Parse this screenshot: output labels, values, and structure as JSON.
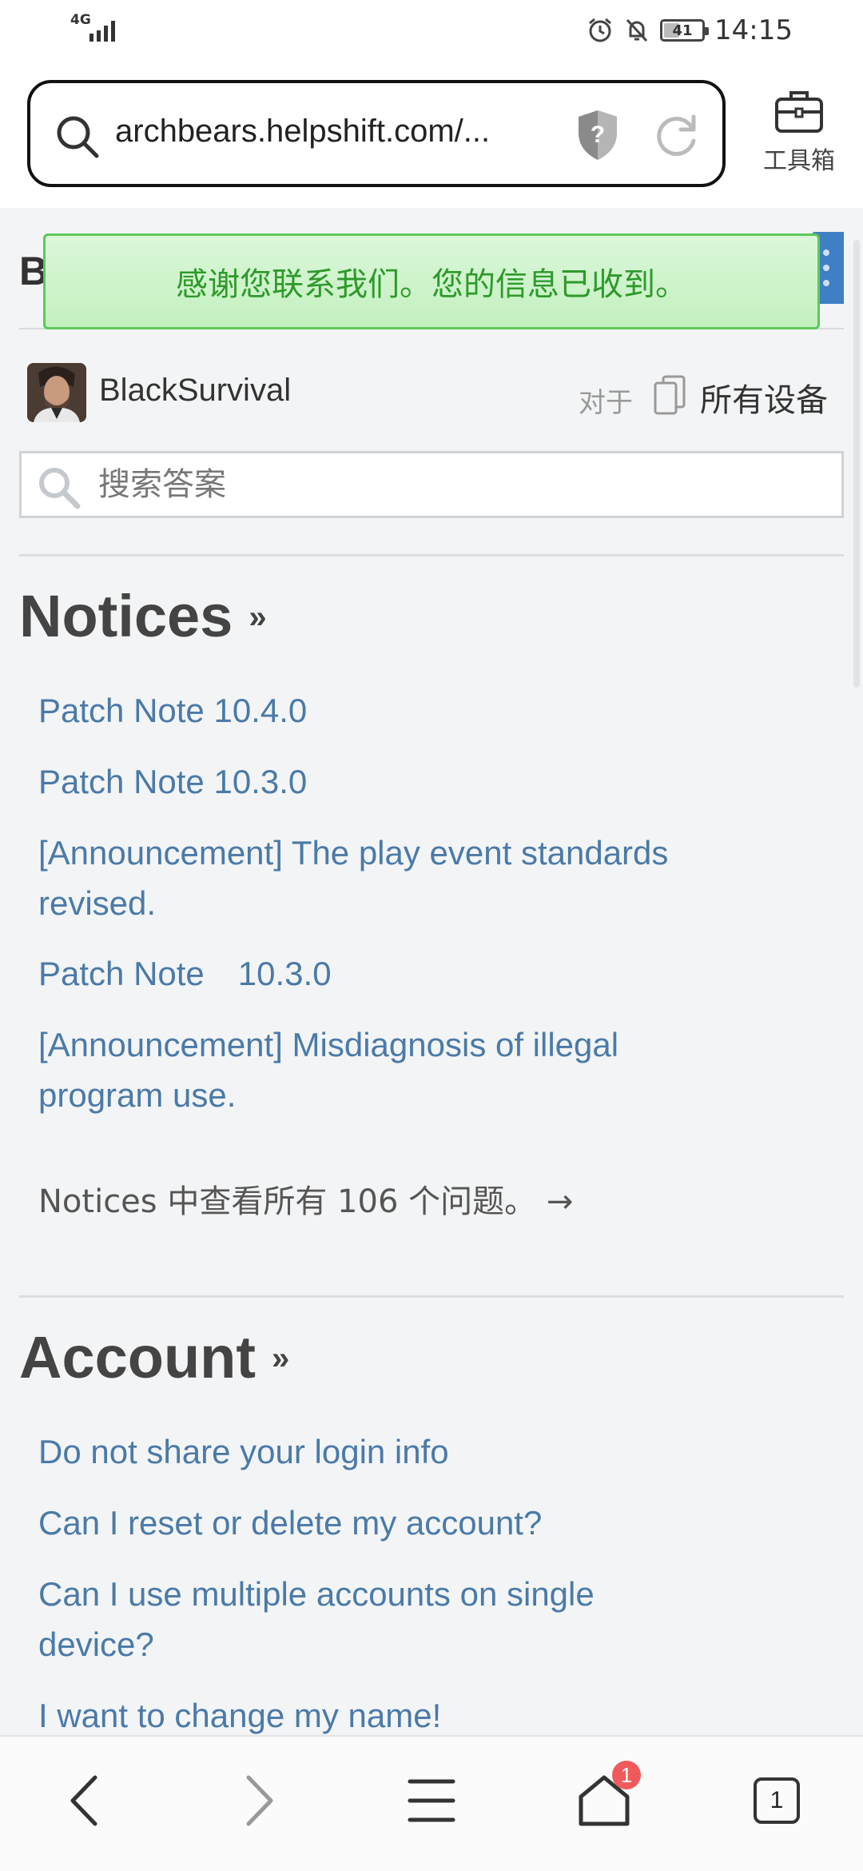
{
  "status_bar": {
    "network": "4G",
    "battery": "41",
    "battery_level": 0.41,
    "time": "14:15"
  },
  "browser": {
    "url": "archbears.helpshift.com/...",
    "toolbox_label": "工具箱"
  },
  "page": {
    "title_letter": "B",
    "toast_message": "感谢您联系我们。您的信息已收到。",
    "app_name": "BlackSurvival",
    "for_label": "对于",
    "devices_label": "所有设备",
    "search_placeholder": "搜索答案",
    "accent_color": "#4a7aa8",
    "sections": [
      {
        "title": "Notices",
        "links": [
          "Patch Note 10.4.0",
          "Patch Note 10.3.0",
          "[Announcement] The play event standards revised.",
          "Patch Note　10.3.0",
          "[Announcement] Misdiagnosis of illegal program use."
        ],
        "view_all": "Notices 中查看所有 106 个问题。 →"
      },
      {
        "title": "Account",
        "links": [
          "Do not share your login info",
          "Can I reset or delete my account?",
          "Can I use multiple accounts on single device?",
          "I want to change my name!"
        ]
      }
    ]
  },
  "bottom_nav": {
    "home_badge": "1",
    "tab_count": "1"
  }
}
